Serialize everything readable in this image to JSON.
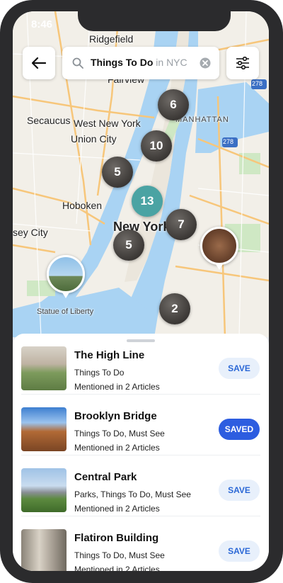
{
  "status_bar": {
    "time": "8:46"
  },
  "header": {
    "back_icon": "arrow-left-icon",
    "search": {
      "query": "Things To Do",
      "location": "in NYC",
      "clear_icon": "clear-circle-icon"
    },
    "filter_icon": "sliders-icon"
  },
  "map": {
    "labels": {
      "ridgefield": "Ridgefield",
      "fairview": "Fairview",
      "secaucus": "Secaucus",
      "west_new_york": "West New York",
      "union_city": "Union City",
      "hoboken": "Hoboken",
      "jersey_city": "sey City",
      "new_york": "New York",
      "statue": "Statue of Liberty",
      "manhattan": "MANHATTAN"
    },
    "clusters": [
      "6",
      "10",
      "5",
      "13",
      "7",
      "5",
      "2"
    ],
    "highway_shields": [
      "278",
      "278"
    ]
  },
  "places": [
    {
      "title": "The High Line",
      "category": "Things To Do",
      "mentions": "Mentioned in 2 Articles",
      "action": "SAVE",
      "saved": false
    },
    {
      "title": "Brooklyn Bridge",
      "category": "Things To Do, Must See",
      "mentions": "Mentioned in 2 Articles",
      "action": "SAVED",
      "saved": true
    },
    {
      "title": "Central Park",
      "category": "Parks, Things To Do, Must See",
      "mentions": "Mentioned in 2 Articles",
      "action": "SAVE",
      "saved": false
    },
    {
      "title": "Flatiron Building",
      "category": "Things To Do, Must See",
      "mentions": "Mentioned in 2 Articles",
      "action": "SAVE",
      "saved": false
    }
  ],
  "colors": {
    "accent": "#2d5de0",
    "save_bg": "#e8f0fb",
    "water": "#a9d3f3",
    "land": "#f2efe8",
    "park": "#cfe8c4"
  }
}
